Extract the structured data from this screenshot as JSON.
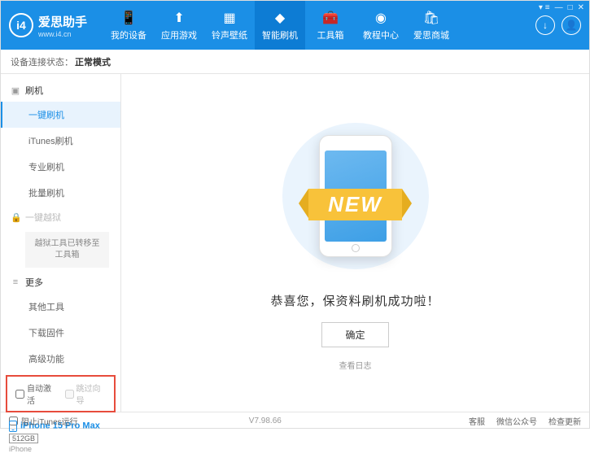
{
  "header": {
    "logo_text": "爱思助手",
    "logo_url": "www.i4.cn",
    "logo_badge": "i4",
    "nav": [
      {
        "label": "我的设备"
      },
      {
        "label": "应用游戏"
      },
      {
        "label": "铃声壁纸"
      },
      {
        "label": "智能刷机"
      },
      {
        "label": "工具箱"
      },
      {
        "label": "教程中心"
      },
      {
        "label": "爱思商城"
      }
    ]
  },
  "status": {
    "prefix": "设备连接状态：",
    "value": "正常模式"
  },
  "sidebar": {
    "flash_header": "刷机",
    "flash_items": [
      "一键刷机",
      "iTunes刷机",
      "专业刷机",
      "批量刷机"
    ],
    "jailbreak_header": "一键越狱",
    "jailbreak_note": "越狱工具已转移至工具箱",
    "more_header": "更多",
    "more_items": [
      "其他工具",
      "下载固件",
      "高级功能"
    ],
    "checkbox1": "自动激活",
    "checkbox2": "跳过向导",
    "device": {
      "name": "iPhone 15 Pro Max",
      "storage": "512GB",
      "type": "iPhone"
    }
  },
  "main": {
    "new_label": "NEW",
    "success": "恭喜您，保资料刷机成功啦！",
    "confirm": "确定",
    "view_log": "查看日志"
  },
  "footer": {
    "block_itunes": "阻止iTunes运行",
    "version": "V7.98.66",
    "links": [
      "客服",
      "微信公众号",
      "检查更新"
    ]
  }
}
